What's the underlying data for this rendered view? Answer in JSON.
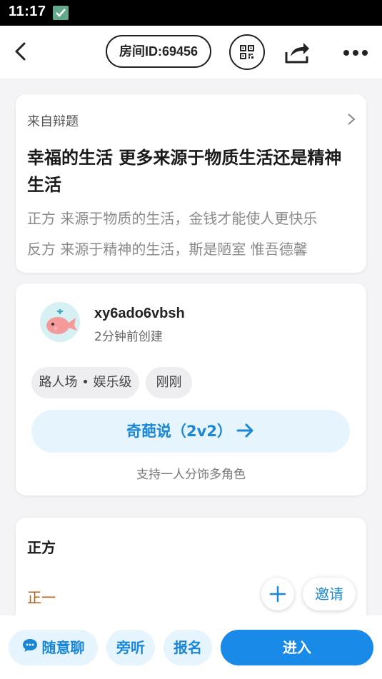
{
  "status": {
    "time": "11:17"
  },
  "header": {
    "room_id": "房间ID:69456"
  },
  "topic": {
    "source": "来自辩题",
    "title": "幸福的生活 更多来源于物质生活还是精神生活",
    "pro": "正方 来源于物质的生活，金钱才能使人更快乐",
    "con": "反方 来源于精神的生活，斯是陋室 惟吾德馨"
  },
  "room": {
    "username": "xy6ado6vbsh",
    "created": "2分钟前创建",
    "tags": [
      "路人场 • 娱乐级",
      "刚刚"
    ],
    "mode": "奇葩说（2v2）",
    "hint": "支持一人分饰多角色"
  },
  "team": {
    "name": "正方",
    "slot": "正一",
    "invite": "邀请"
  },
  "bottom": {
    "chat": "随意聊",
    "listen": "旁听",
    "signup": "报名",
    "enter": "进入"
  },
  "colors": {
    "accent": "#1a8ae8",
    "accent_light": "#e6f4fd",
    "slot_text": "#b4601a"
  }
}
